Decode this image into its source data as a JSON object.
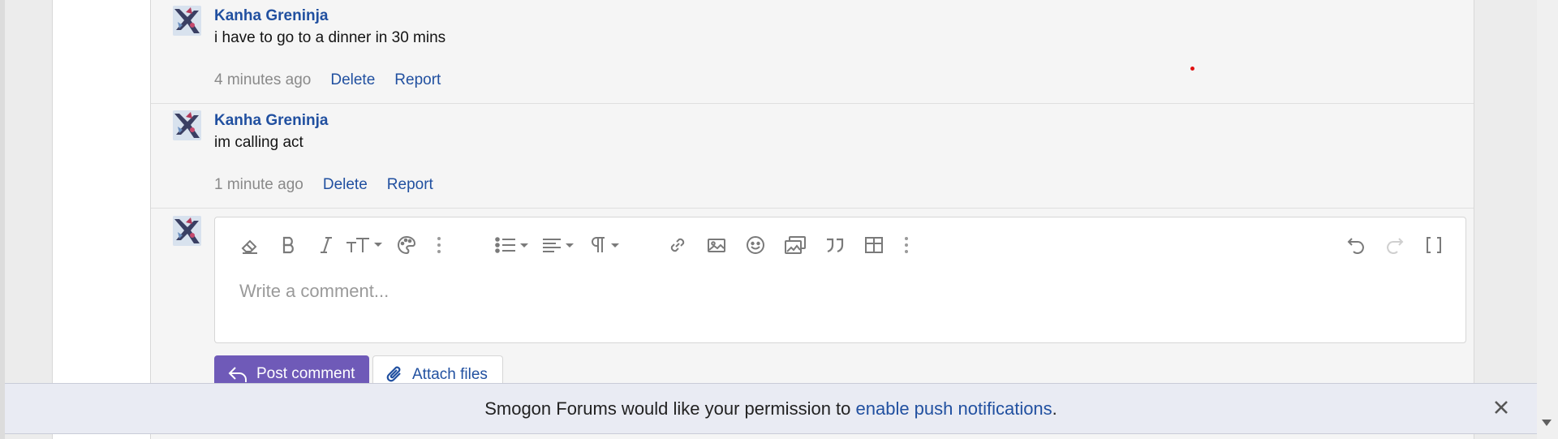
{
  "comments": [
    {
      "author": "Kanha Greninja",
      "text": "i have to go to a dinner in 30 mins",
      "time": "4 minutes ago",
      "delete_label": "Delete",
      "report_label": "Report"
    },
    {
      "author": "Kanha Greninja",
      "text": "im calling act",
      "time": "1 minute ago",
      "delete_label": "Delete",
      "report_label": "Report"
    }
  ],
  "editor": {
    "placeholder": "Write a comment...",
    "toolbar_icons": [
      "clear-formatting-icon",
      "bold-icon",
      "italic-icon",
      "text-size-icon",
      "text-color-icon",
      "more-text-options-icon",
      "list-icon",
      "align-icon",
      "paragraph-format-icon",
      "insert-link-icon",
      "insert-image-icon",
      "insert-emoji-icon",
      "insert-media-icon",
      "quote-icon",
      "insert-table-icon",
      "more-insert-options-icon",
      "undo-icon",
      "redo-icon",
      "toggle-fullscreen-icon"
    ],
    "post_label": "Post comment",
    "attach_label": "Attach files"
  },
  "push_notice": {
    "text_before": "Smogon Forums would like your permission to ",
    "link_text": "enable push notifications",
    "text_after": "."
  },
  "colors": {
    "link": "#2150a0",
    "post_button": "#6f5ab8",
    "notice_bg": "#e9ebf3"
  }
}
